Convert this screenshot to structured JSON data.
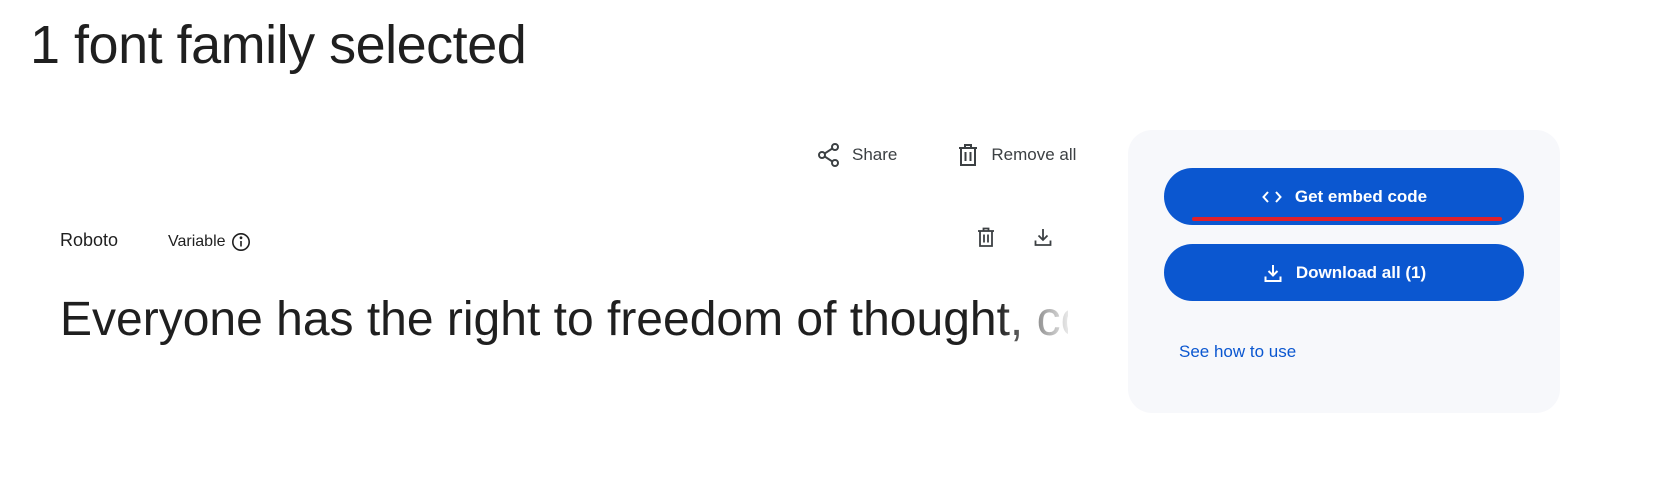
{
  "page": {
    "title": "1 font family selected"
  },
  "toolbar": {
    "share_label": "Share",
    "share_icon": "share-icon",
    "remove_all_label": "Remove all",
    "remove_all_icon": "trash-icon"
  },
  "font": {
    "family": "Roboto",
    "axis_type": "Variable",
    "info_icon": "info-icon",
    "remove_icon": "trash-icon",
    "download_icon": "download-icon",
    "preview_text": "Everyone has the right to freedom of thought, conscience and religion"
  },
  "panel": {
    "embed_label": "Get embed code",
    "embed_icon": "code-icon",
    "download_all_label": "Download all (1)",
    "download_all_icon": "download-icon",
    "how_to_use_label": "See how to use"
  },
  "colors": {
    "primary": "#0b57d0",
    "panel_background": "#f7f8fb",
    "highlight_underline": "#e0202a",
    "text": "#1f1f1f"
  }
}
